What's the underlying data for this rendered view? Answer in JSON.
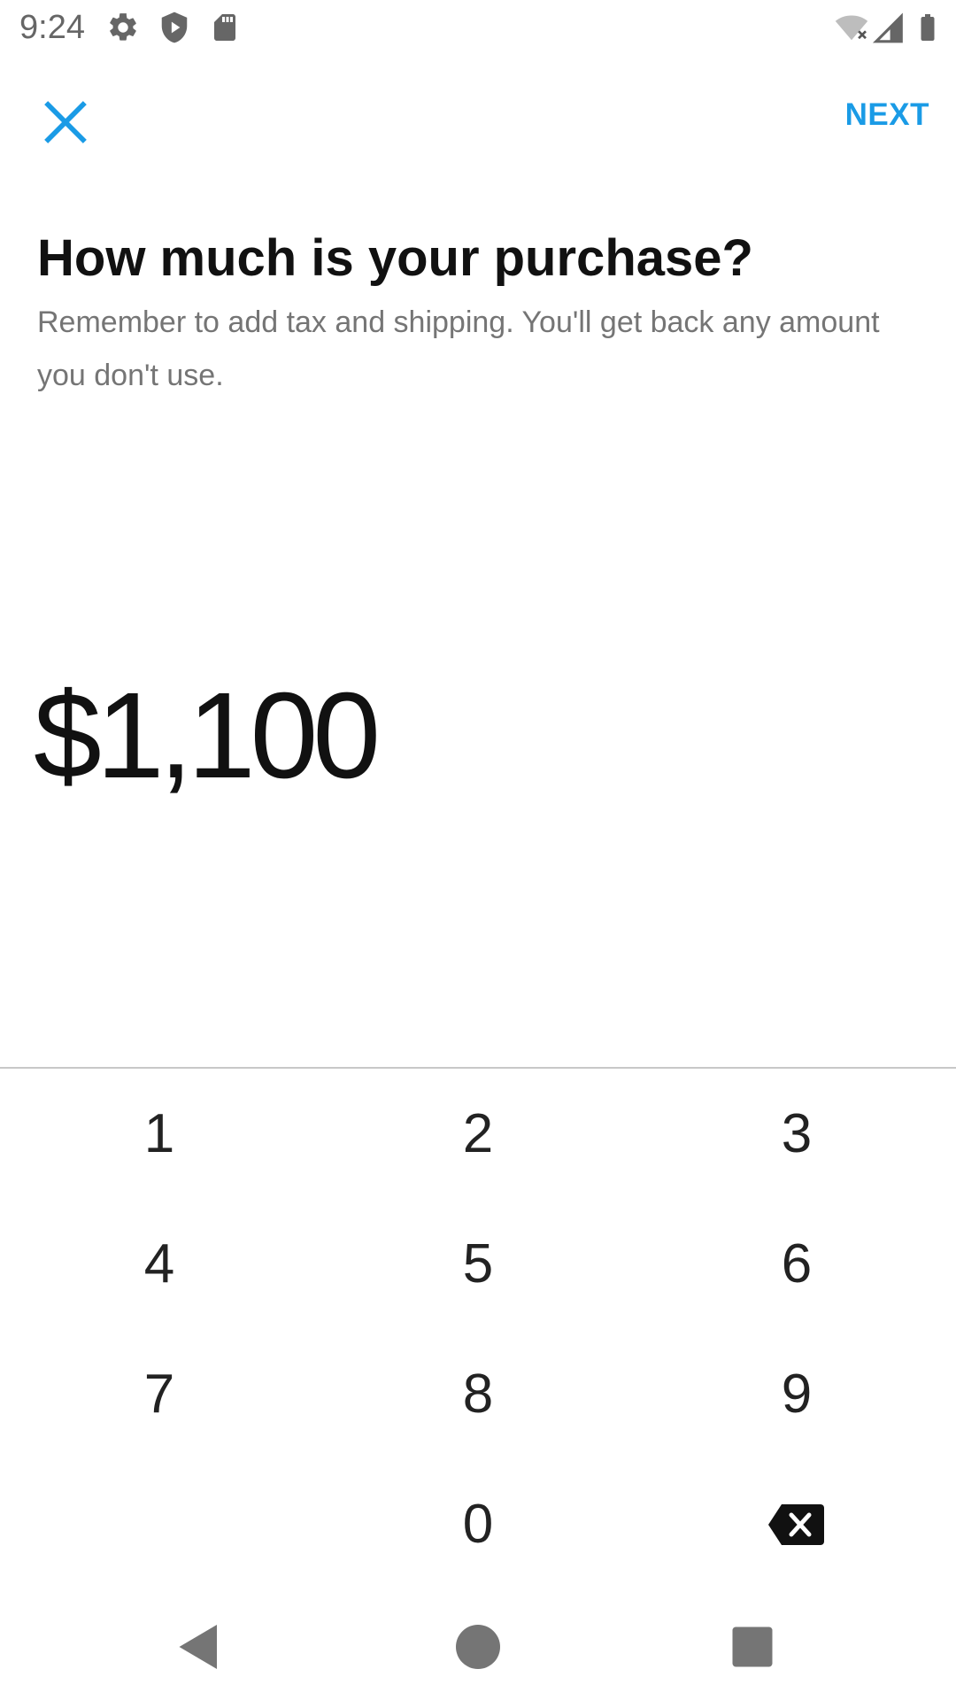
{
  "status_bar": {
    "time": "9:24",
    "left_icons": [
      "gear-icon",
      "shield-icon",
      "sd-card-icon"
    ],
    "right_icons": [
      "wifi-off-icon",
      "signal-icon",
      "battery-icon"
    ]
  },
  "app_bar": {
    "close_icon": "close-icon",
    "next_label": "NEXT",
    "accent_color": "#1a9be6"
  },
  "content": {
    "title": "How much is your purchase?",
    "subtitle": "Remember to add tax and shipping. You'll get back any amount you don't use.",
    "amount": "$1,100"
  },
  "keypad": {
    "keys": [
      "1",
      "2",
      "3",
      "4",
      "5",
      "6",
      "7",
      "8",
      "9",
      "0"
    ],
    "backspace_icon": "backspace-icon"
  },
  "nav_bar": {
    "icons": [
      "back-icon",
      "home-icon",
      "recents-icon"
    ]
  }
}
